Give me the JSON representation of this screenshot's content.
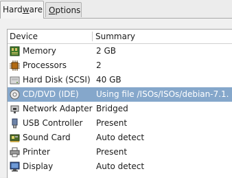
{
  "tabs": [
    {
      "label_pre": "Hard",
      "label_u": "w",
      "label_post": "are",
      "active": true
    },
    {
      "label_pre": "",
      "label_u": "O",
      "label_post": "ptions",
      "active": false
    }
  ],
  "columns": {
    "device": "Device",
    "summary": "Summary"
  },
  "devices": [
    {
      "name": "Memory",
      "summary": "2 GB",
      "icon": "memory-icon"
    },
    {
      "name": "Processors",
      "summary": "2",
      "icon": "processor-icon"
    },
    {
      "name": "Hard Disk (SCSI)",
      "summary": "40 GB",
      "icon": "hard-disk-icon"
    },
    {
      "name": "CD/DVD (IDE)",
      "summary": "Using file /ISOs/ISOs/debian-7.1.",
      "icon": "cd-dvd-icon",
      "selected": true
    },
    {
      "name": "Network Adapter",
      "summary": "Bridged",
      "icon": "network-adapter-icon"
    },
    {
      "name": "USB Controller",
      "summary": "Present",
      "icon": "usb-icon"
    },
    {
      "name": "Sound Card",
      "summary": "Auto detect",
      "icon": "sound-card-icon"
    },
    {
      "name": "Printer",
      "summary": "Present",
      "icon": "printer-icon"
    },
    {
      "name": "Display",
      "summary": "Auto detect",
      "icon": "display-icon"
    }
  ],
  "colors": {
    "selection": "#85a7cb",
    "window": "#ececec"
  }
}
